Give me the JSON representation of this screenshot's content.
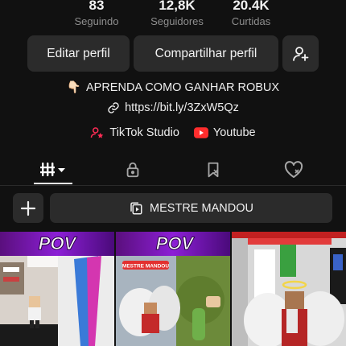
{
  "stats": [
    {
      "value": "83",
      "label": "Seguindo"
    },
    {
      "value": "12,8K",
      "label": "Seguidores"
    },
    {
      "value": "20.4K",
      "label": "Curtidas"
    }
  ],
  "buttons": {
    "edit_profile": "Editar perfil",
    "share_profile": "Compartilhar perfil",
    "add_friend_icon": "person-add-icon"
  },
  "bio": {
    "emoji": "👇🏻",
    "text": "APRENDA COMO GANHAR ROBUX",
    "link": "https://bit.ly/3ZxW5Qz"
  },
  "links": [
    {
      "label": "TikTok Studio",
      "icon": "tiktok-studio-icon"
    },
    {
      "label": "Youtube",
      "icon": "youtube-icon"
    }
  ],
  "tabs": [
    {
      "icon": "grid-icon",
      "active": true
    },
    {
      "icon": "lock-icon",
      "active": false
    },
    {
      "icon": "bookmark-icon",
      "active": false
    },
    {
      "icon": "liked-heart-icon",
      "active": false
    }
  ],
  "playlist": {
    "add_icon": "plus-icon",
    "label": "MESTRE MANDOU"
  },
  "videos": [
    {
      "overlay_text": "POV",
      "tag": ""
    },
    {
      "overlay_text": "POV",
      "tag": "MESTRE MANDOU"
    },
    {
      "overlay_text": "",
      "tag": ""
    }
  ],
  "colors": {
    "background": "#111111",
    "button_bg": "#2b2b2b",
    "youtube_red": "#ff2d2d",
    "tiktok_pink": "#fe2c55"
  }
}
